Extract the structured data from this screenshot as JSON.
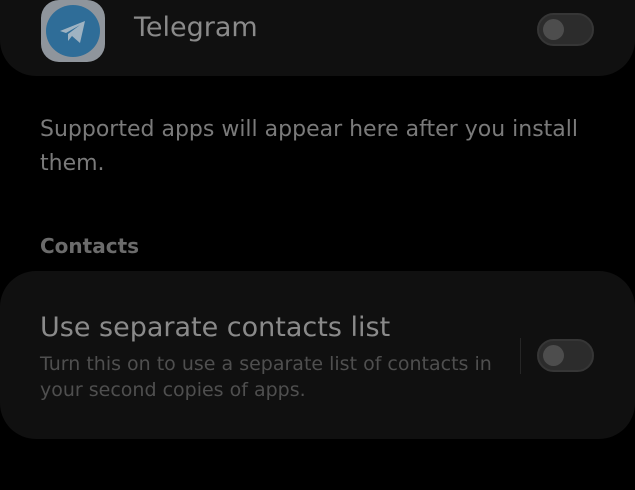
{
  "apps": {
    "telegram": {
      "label": "Telegram",
      "icon": "telegram-icon",
      "enabled": false
    }
  },
  "info_text": "Supported apps will appear here after you install them.",
  "contacts_section": {
    "header": "Contacts",
    "setting": {
      "title": "Use separate contacts list",
      "description": "Turn this on to use a separate list of contacts in your second copies of apps.",
      "enabled": false
    }
  },
  "colors": {
    "background": "#000000",
    "card": "#101010",
    "telegram_blue": "#2f6d98"
  }
}
